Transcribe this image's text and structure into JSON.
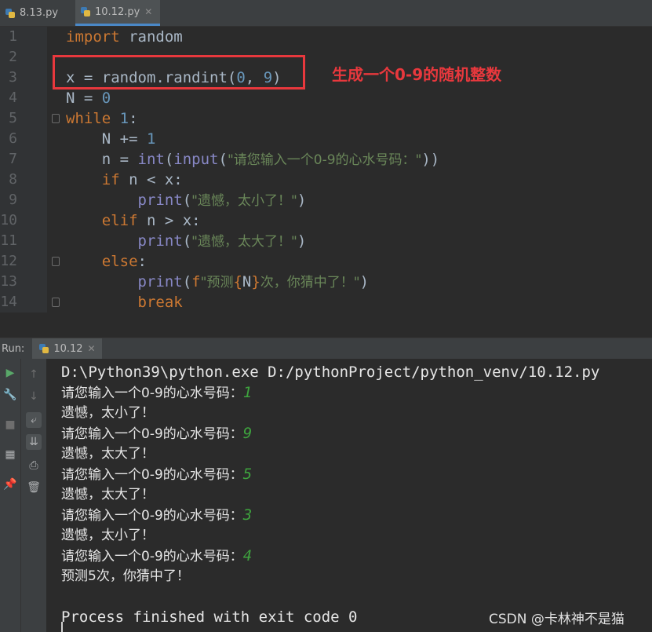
{
  "tabs": [
    {
      "label": "8.13.py"
    },
    {
      "label": "10.12.py",
      "active": true
    }
  ],
  "editor": {
    "line_numbers": [
      "1",
      "2",
      "3",
      "4",
      "5",
      "6",
      "7",
      "8",
      "9",
      "10",
      "11",
      "12",
      "13",
      "14"
    ],
    "annotation": "生成一个0-9的随机整数",
    "lines": {
      "l1_kw": "import",
      "l1_rest": " random",
      "l3_a": "x = random.randint(",
      "l3_n1": "0",
      "l3_b": ", ",
      "l3_n2": "9",
      "l3_c": ")",
      "l4_a": "N = ",
      "l4_n": "0",
      "l5_kw": "while",
      "l5_sp": " ",
      "l5_n": "1",
      "l5_c": ":",
      "l6_a": "    N += ",
      "l6_n": "1",
      "l7_a": "    n = ",
      "l7_f1": "int",
      "l7_p1": "(",
      "l7_f2": "input",
      "l7_p2": "(",
      "l7_s": "\"请您输入一个0-9的心水号码：\"",
      "l7_e": "))",
      "l8_in": "    ",
      "l8_kw": "if",
      "l8_rest": " n < x:",
      "l9_in": "        ",
      "l9_f": "print",
      "l9_p": "(",
      "l9_s": "\"遗憾，太小了！\"",
      "l9_e": ")",
      "l10_in": "    ",
      "l10_kw": "elif",
      "l10_rest": " n > x:",
      "l11_in": "        ",
      "l11_f": "print",
      "l11_p": "(",
      "l11_s": "\"遗憾，太大了！\"",
      "l11_e": ")",
      "l12_in": "    ",
      "l12_kw": "else",
      "l12_rest": ":",
      "l13_in": "        ",
      "l13_f": "print",
      "l13_p": "(",
      "l13_pre": "f",
      "l13_s1": "\"预测",
      "l13_b1": "{",
      "l13_v": "N",
      "l13_b2": "}",
      "l13_s2": "次，你猜中了！\"",
      "l13_e": ")",
      "l14_in": "        ",
      "l14_kw": "break"
    }
  },
  "run": {
    "label": "Run:",
    "tab": "10.12",
    "console": {
      "command": "D:\\Python39\\python.exe D:/pythonProject/python_venv/10.12.py",
      "prompt": "请您输入一个0-9的心水号码：",
      "inputs": [
        "1",
        "9",
        "5",
        "3",
        "4"
      ],
      "too_small": "遗憾，太小了！",
      "too_big": "遗憾，太大了！",
      "result": "预测5次，你猜中了！",
      "exit": "Process finished with exit code 0"
    }
  },
  "watermark": "CSDN @卡林神不是猫",
  "colors": {
    "keyword": "#cc7832",
    "number": "#6897bb",
    "string": "#6a8759",
    "builtin": "#8888c6",
    "annotation": "#e8383d",
    "user_input": "#3ea33e"
  }
}
